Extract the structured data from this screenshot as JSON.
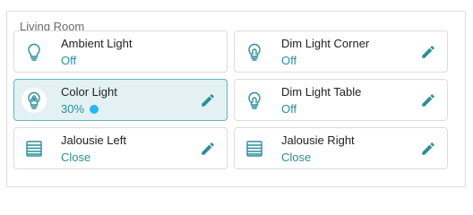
{
  "room": {
    "title": "Living Room"
  },
  "colors": {
    "accent": "#2a8f9b",
    "active_background": "#e3f1f3",
    "active_border": "#5fb6c3",
    "icon": "#2a8f9b",
    "edit_icon": "#2a8f9b",
    "level_dot": "#2bb4f0"
  },
  "devices": [
    {
      "name": "Ambient Light",
      "state": "Off",
      "icon": "lightbulb-icon",
      "editable": false,
      "active": false
    },
    {
      "name": "Dim Light Corner",
      "state": "Off",
      "icon": "lightbulb-icon",
      "editable": true,
      "active": false
    },
    {
      "name": "Color Light",
      "state": "30%",
      "icon": "color-bulb-icon",
      "editable": true,
      "active": true,
      "level_indicator": true
    },
    {
      "name": "Dim Light Table",
      "state": "Off",
      "icon": "lightbulb-icon",
      "editable": true,
      "active": false
    },
    {
      "name": "Jalousie Left",
      "state": "Close",
      "icon": "blinds-icon",
      "editable": true,
      "active": false
    },
    {
      "name": "Jalousie Right",
      "state": "Close",
      "icon": "blinds-icon",
      "editable": true,
      "active": false
    }
  ]
}
